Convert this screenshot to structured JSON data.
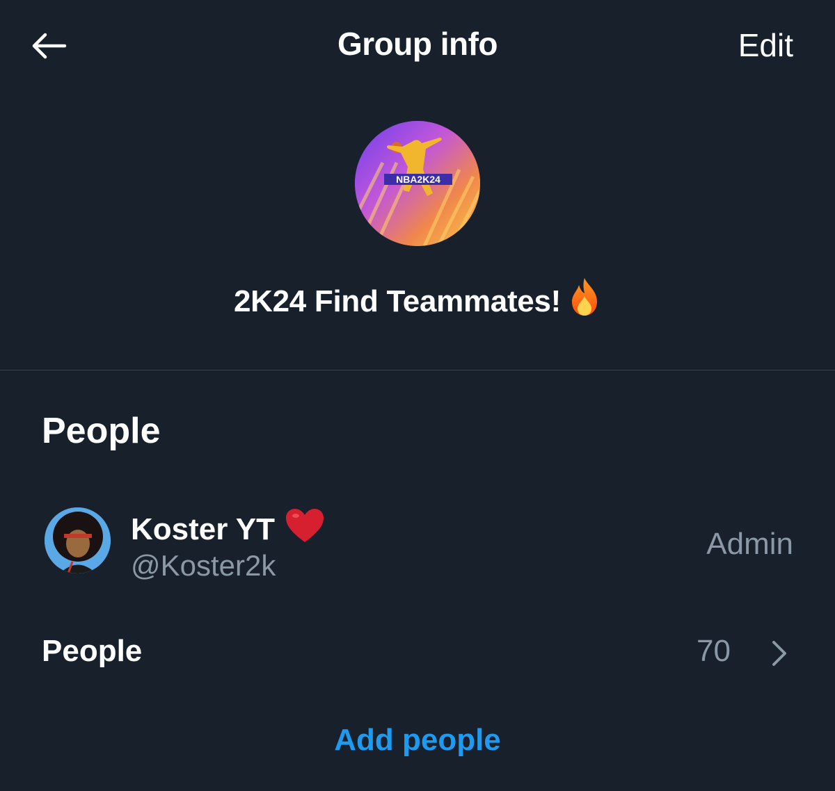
{
  "header": {
    "title": "Group info",
    "edit_label": "Edit",
    "back_icon": "arrow-left-icon"
  },
  "group": {
    "name": "2K24 Find Teammates!",
    "name_emoji": "🔥",
    "avatar_text": "NBA2K24"
  },
  "people_section": {
    "title": "People",
    "members": [
      {
        "display_name": "Koster YT",
        "name_emoji": "❤️",
        "handle": "@Koster2k",
        "role": "Admin"
      }
    ],
    "people_row_label": "People",
    "people_count": "70",
    "add_people_label": "Add people"
  },
  "colors": {
    "background": "#17202b",
    "text_primary": "#ffffff",
    "text_secondary": "#8b98a5",
    "accent": "#1d9bf0",
    "divider": "#38444d"
  }
}
